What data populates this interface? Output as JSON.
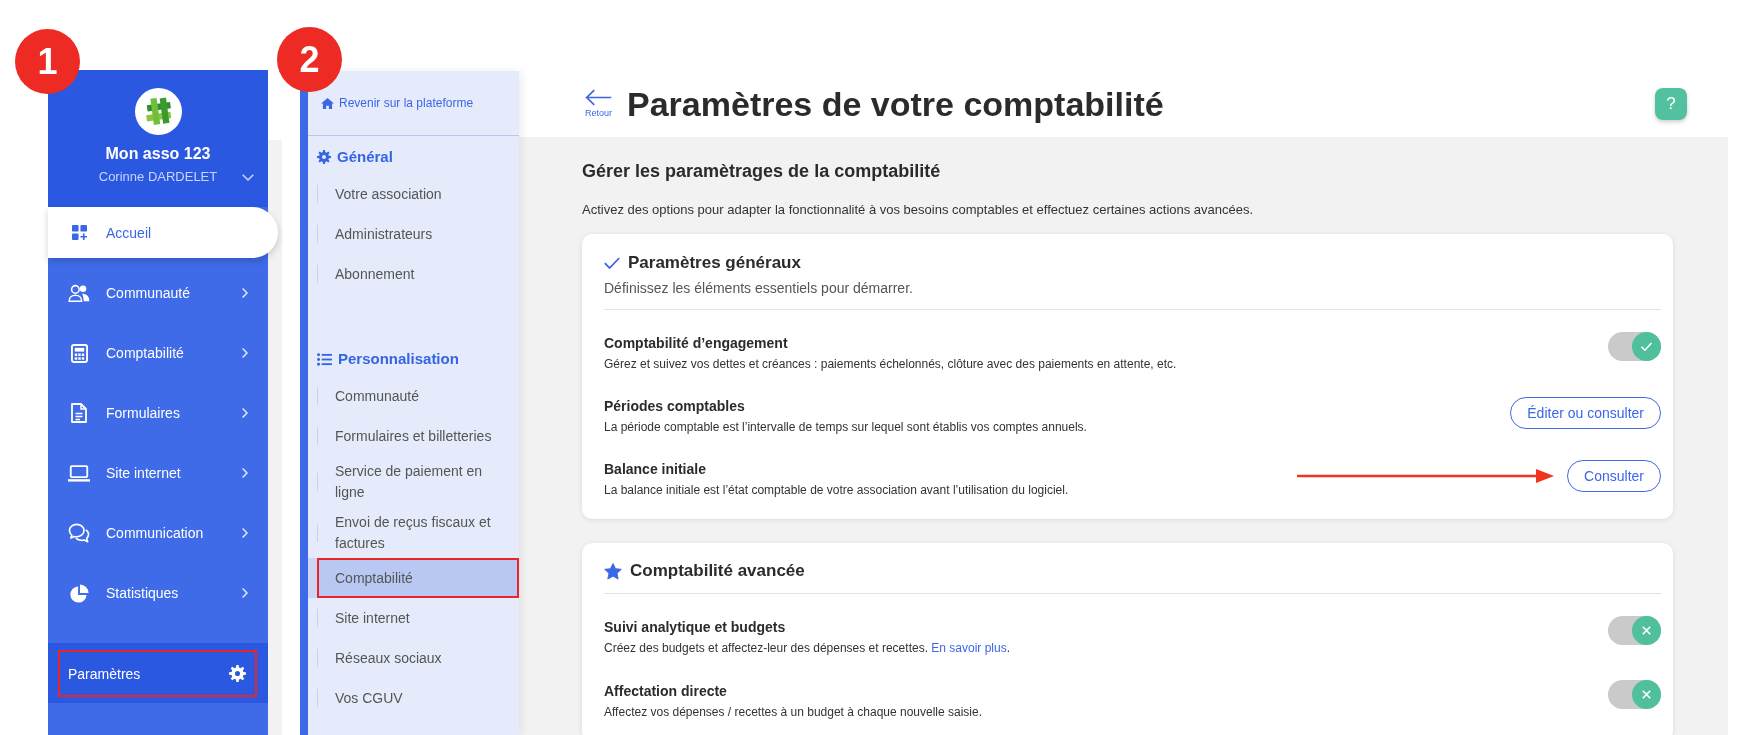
{
  "sidebar": {
    "badge": "1",
    "org_name": "Mon asso 123",
    "user_name": "Corinne DARDELET",
    "items": [
      {
        "label": "Accueil",
        "selected": true,
        "submenu": false
      },
      {
        "label": "Communauté",
        "selected": false,
        "submenu": true
      },
      {
        "label": "Comptabilité",
        "selected": false,
        "submenu": true
      },
      {
        "label": "Formulaires",
        "selected": false,
        "submenu": true
      },
      {
        "label": "Site internet",
        "selected": false,
        "submenu": true
      },
      {
        "label": "Communication",
        "selected": false,
        "submenu": true
      },
      {
        "label": "Statistiques",
        "selected": false,
        "submenu": true
      }
    ],
    "footer_item": {
      "label": "Paramètres",
      "highlighted": true
    }
  },
  "settings_nav": {
    "badge": "2",
    "back_link": "Revenir sur la plateforme",
    "groups": [
      {
        "heading": "Général",
        "items": [
          {
            "label": "Votre association",
            "selected": false
          },
          {
            "label": "Administrateurs",
            "selected": false
          },
          {
            "label": "Abonnement",
            "selected": false
          }
        ]
      },
      {
        "heading": "Personnalisation",
        "items": [
          {
            "label": "Communauté",
            "selected": false
          },
          {
            "label": "Formulaires et billetteries",
            "selected": false
          },
          {
            "label": "Service de paiement en ligne",
            "selected": false
          },
          {
            "label": "Envoi de reçus fiscaux et factures",
            "selected": false
          },
          {
            "label": "Comptabilité",
            "selected": true,
            "highlighted": true
          },
          {
            "label": "Site internet",
            "selected": false
          },
          {
            "label": "Réseaux sociaux",
            "selected": false
          },
          {
            "label": "Vos CGUV",
            "selected": false
          }
        ]
      }
    ]
  },
  "header": {
    "back_label": "Retour",
    "title": "Paramètres de votre comptabilité",
    "help": "?"
  },
  "content": {
    "heading": "Gérer les paramètrages de la comptabilité",
    "intro": "Activez des options pour adapter la fonctionnalité à vos besoins comptables et effectuez certaines actions avancées.",
    "sections": [
      {
        "title": "Paramètres généraux",
        "subtitle": "Définissez les éléments essentiels pour démarrer.",
        "rows": [
          {
            "kind": "toggle",
            "title": "Comptabilité d’engagement",
            "description": "Gérez et suivez vos dettes et créances : paiements échelonnés, clôture avec des paiements en attente, etc.",
            "on": true
          },
          {
            "kind": "button",
            "title": "Périodes comptables",
            "description": "La période comptable est l’intervalle de temps sur lequel sont établis vos comptes annuels.",
            "button": "Éditer ou consulter"
          },
          {
            "kind": "button",
            "title": "Balance initiale",
            "description": "La balance initiale est l’état comptable de votre association avant l’utilisation du logiciel.",
            "button": "Consulter",
            "annotated": true
          }
        ]
      },
      {
        "title": "Comptabilité avancée",
        "rows": [
          {
            "kind": "toggle",
            "title": "Suivi analytique et budgets",
            "description": "Créez des budgets et affectez-leur des dépenses et recettes.",
            "link": "En savoir plus",
            "link_suffix": ".",
            "on": false
          },
          {
            "kind": "toggle",
            "title": "Affectation directe",
            "description": "Affectez vos dépenses / recettes à un budget à chaque nouvelle saisie.",
            "on": false
          }
        ]
      }
    ]
  }
}
